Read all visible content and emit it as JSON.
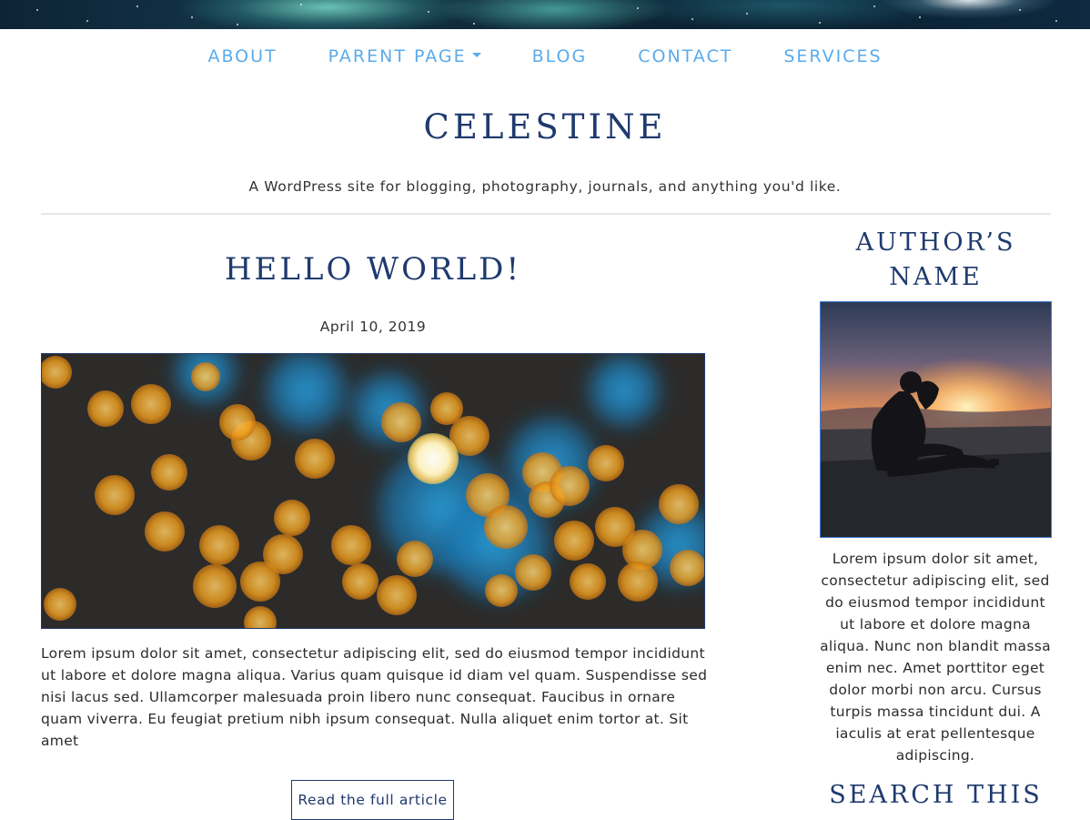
{
  "nav": {
    "items": [
      {
        "label": "ABOUT"
      },
      {
        "label": "PARENT PAGE",
        "has_dropdown": true
      },
      {
        "label": "BLOG"
      },
      {
        "label": "CONTACT"
      },
      {
        "label": "SERVICES"
      }
    ],
    "color": "#5aabeb"
  },
  "site": {
    "title": "CELESTINE",
    "tagline": "A WordPress site for blogging, photography, journals, and anything you'd like."
  },
  "post": {
    "title": "HELLO WORLD!",
    "date": "April 10, 2019",
    "excerpt": "Lorem ipsum dolor sit amet, consectetur adipiscing elit, sed do eiusmod tempor incididunt ut labore et dolore magna aliqua. Varius quam quisque id diam vel quam. Suspendisse sed nisi lacus sed. Ullamcorper malesuada proin libero nunc consequat. Faucibus in ornare quam viverra. Eu feugiat pretium nibh ipsum consequat. Nulla aliquet enim tortor at. Sit amet",
    "read_more_label": "Read the full article"
  },
  "sidebar": {
    "author_heading": "AUTHOR’S NAME",
    "author_bio": "Lorem ipsum dolor sit amet, consectetur adipiscing elit, sed do eiusmod tempor incididunt ut labore et dolore magna aliqua. Nunc non blandit massa enim nec. Amet porttitor eget dolor morbi non arcu. Cursus turpis massa tincidunt dui. A iaculis at erat pellentesque adipiscing.",
    "search_heading": "SEARCH THIS"
  },
  "colors": {
    "heading": "#1f3a6e",
    "link": "#5aabeb",
    "divider": "#e8e8e8"
  }
}
